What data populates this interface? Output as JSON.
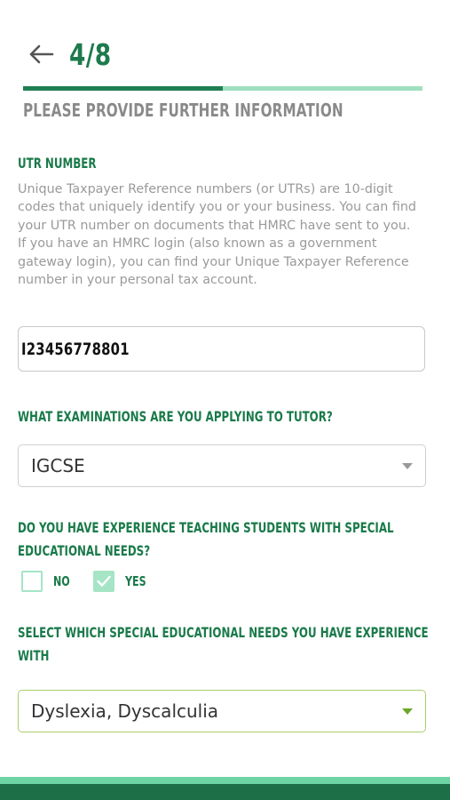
{
  "header": {
    "back_icon": "arrow-left-icon",
    "step": "4/8",
    "progress_fraction": 0.5
  },
  "page_title": "PLEASE PROVIDE FURTHER INFORMATION",
  "utr": {
    "label": "UTR NUMBER",
    "help": "Unique Taxpayer Reference numbers (or UTRs) are 10-digit codes that uniquely identify you or your business. You can find your UTR number on documents that HMRC have sent to you. If you have an HMRC login (also known as a government gateway login), you can find your Unique Taxpayer Reference number in your personal tax account.",
    "value": "I23456778801"
  },
  "examinations": {
    "label": "WHAT EXAMINATIONS ARE YOU APPLYING TO TUTOR?",
    "selected": "IGCSE",
    "caret_icon": "caret-down-icon"
  },
  "sen_experience": {
    "label_line1": "DO YOU HAVE EXPERIENCE TEACHING STUDENTS WITH SPECIAL",
    "label_line2": "EDUCATIONAL NEEDS?",
    "no_label": "NO",
    "no_checked": false,
    "yes_label": "YES",
    "yes_checked": true
  },
  "sen_select": {
    "label_line1": "SELECT WHICH SPECIAL EDUCATIONAL NEEDS YOU HAVE EXPERIENCE",
    "label_line2": "WITH",
    "selected": "Dyslexia, Dyscalculia",
    "caret_icon": "caret-down-icon"
  },
  "colors": {
    "brand_dark": "#1d7a4c",
    "brand_light": "#9fdfc0",
    "checkbox": "#a6e4c6",
    "active_border": "#a9cf6a",
    "active_caret": "#6aa62a"
  }
}
